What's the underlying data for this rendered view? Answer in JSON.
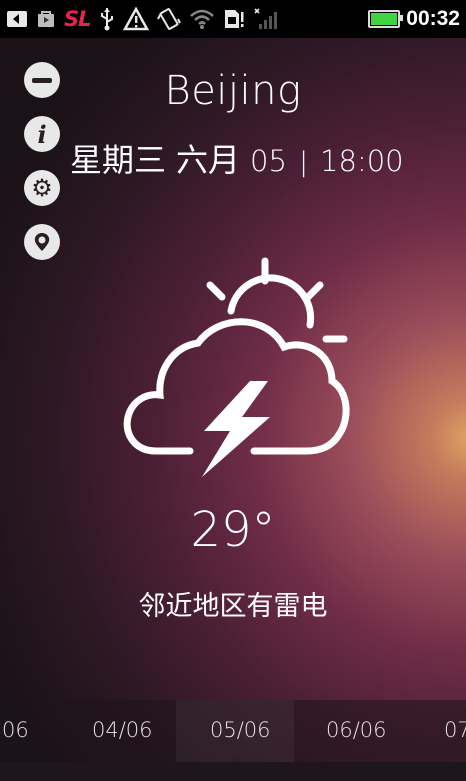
{
  "status_bar": {
    "icons": [
      "usb-back-icon",
      "shopping-bag-icon",
      "sl-app-icon",
      "usb-icon",
      "warning-icon",
      "vibrate-icon",
      "wifi-icon",
      "sim-alert-icon",
      "signal-icon",
      "battery-icon"
    ],
    "app_badge": "SL",
    "time": "00:32",
    "battery_level_percent": 100,
    "battery_color": "#3fd43f"
  },
  "sidebar": {
    "items": [
      "minus-icon",
      "info-icon",
      "settings-icon",
      "location-icon"
    ]
  },
  "header": {
    "city": "Beijing",
    "weekday": "星期三",
    "month": "六月",
    "day": "05",
    "separator": "|",
    "time": "18:00"
  },
  "weather": {
    "icon": "thunderstorm-partly-sunny-icon",
    "temperature": "29°",
    "description": "邻近地区有雷电"
  },
  "timeline": {
    "dates": [
      "06",
      "04/06",
      "05/06",
      "06/06",
      "07"
    ],
    "selected_index": 2
  }
}
